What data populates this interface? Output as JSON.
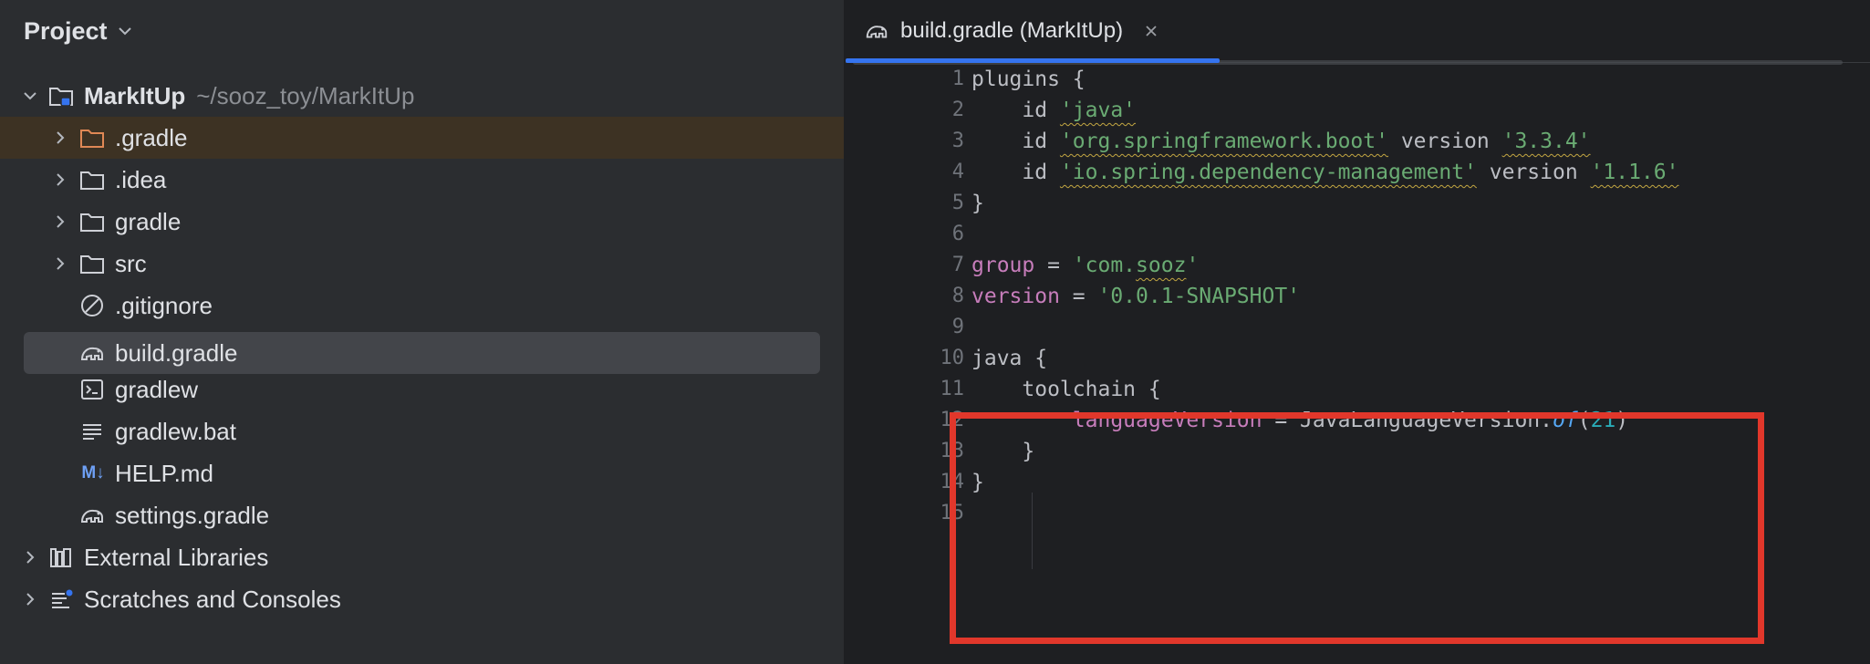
{
  "project_panel": {
    "title": "Project",
    "tree": [
      {
        "label": "MarkItUp",
        "path": "~/sooz_toy/MarkItUp",
        "icon": "module-folder-icon",
        "expanded": true
      },
      {
        "label": ".gradle",
        "icon": "folder-icon",
        "expanded": false,
        "state": "excluded"
      },
      {
        "label": ".idea",
        "icon": "folder-icon",
        "expanded": false
      },
      {
        "label": "gradle",
        "icon": "folder-icon",
        "expanded": false
      },
      {
        "label": "src",
        "icon": "folder-icon",
        "expanded": false
      },
      {
        "label": ".gitignore",
        "icon": "ignored-file-icon"
      },
      {
        "label": "build.gradle",
        "icon": "gradle-elephant-icon",
        "state": "selected"
      },
      {
        "label": "gradlew",
        "icon": "terminal-script-icon"
      },
      {
        "label": "gradlew.bat",
        "icon": "text-file-icon"
      },
      {
        "label": "HELP.md",
        "icon": "markdown-icon",
        "icon_text": "M↓"
      },
      {
        "label": "settings.gradle",
        "icon": "gradle-elephant-icon"
      },
      {
        "label": "External Libraries",
        "icon": "library-icon",
        "expanded": false
      },
      {
        "label": "Scratches and Consoles",
        "icon": "scratches-icon",
        "expanded": false
      }
    ]
  },
  "editor": {
    "tab": {
      "label": "build.gradle (MarkItUp)",
      "icon": "gradle-elephant-icon",
      "close_icon": "close-icon"
    },
    "line_numbers": [
      "1",
      "2",
      "3",
      "4",
      "5",
      "6",
      "7",
      "8",
      "9",
      "10",
      "11",
      "12",
      "13",
      "14",
      "15"
    ],
    "code": {
      "l1_a": "plugins {",
      "l2_a": "    id ",
      "l2_b": "'java'",
      "l3_a": "    id ",
      "l3_b": "'org.springframework.boot'",
      "l3_c": " version ",
      "l3_d": "'3.3.4'",
      "l4_a": "    id ",
      "l4_b": "'io.spring.dependency-management'",
      "l4_c": " version ",
      "l4_d": "'1.1.6'",
      "l5_a": "}",
      "l7_a": "group",
      "l7_b": " = ",
      "l7_c": "'com.",
      "l7_d": "sooz",
      "l7_e": "'",
      "l8_a": "version",
      "l8_b": " = ",
      "l8_c": "'0.0.1-SNAPSHOT'",
      "l10_a": "java {",
      "l11_a": "    toolchain {",
      "l12_a": "        ",
      "l12_b": "languageVersion",
      "l12_c": " = JavaLanguageVersion.",
      "l12_d": "of",
      "l12_e": "(",
      "l12_f": "21",
      "l12_g": ")",
      "l13_a": "    }",
      "l14_a": "}"
    },
    "colors": {
      "string": "#6aab73",
      "property": "#c77dbb",
      "number": "#2aacb8",
      "method": "#56a8f5",
      "highlight_box": "#e1372b",
      "warning_underline": "#c3a742"
    }
  }
}
